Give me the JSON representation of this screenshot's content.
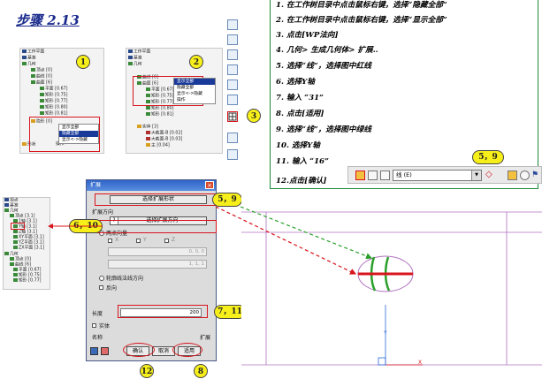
{
  "title": "步骤 2.13",
  "instructions": [
    "1. 在工作树目录中点击鼠标右键，选择“隐藏全部”",
    "2. 在工作树目录中点击鼠标右键，选择“显示全部”",
    "3. 点击[WP法向]",
    "4. 几何> 生成几何体> 扩展..",
    "5. 选择“线”，选择图中红线",
    "6. 选择Y轴",
    "7. 输入 “31”",
    "8. 点击[适用]",
    "9. 选择“线”，选择图中绿线",
    "10. 选择Y轴",
    "11. 输入 “16”",
    "12.点击[确认]"
  ],
  "badges": {
    "b1": "1",
    "b2": "2",
    "b3": "3",
    "b5_9_top": "5，9",
    "b5_9_dialog": "5，9",
    "b6_10": "6，10",
    "b7_11": "7，11",
    "b12": "12",
    "b8": "8"
  },
  "tree1": {
    "rows": [
      "工作平面",
      "基准",
      "几何",
      "顶点 [0]",
      "曲线 [0]",
      "曲面 [6]",
      "平面 [0.67]",
      "矩形 [0.75]",
      "矩形 [0.77]",
      "矩形 [0.80]",
      "矩形 [0.81]",
      "隐形 [0]",
      "形状",
      "操作"
    ],
    "menu": [
      "显示全部",
      "隐藏全部",
      "显示<->隐藏"
    ]
  },
  "tree2": {
    "rows": [
      "工作平面",
      "基准",
      "几何",
      "曲线 [0]",
      "曲面 [6]",
      "平面 [0.67]",
      "矩形 [0.75]",
      "矩形 [0.77]",
      "矩形 [0.80]",
      "矩形 [0.81]",
      "实体 [3]",
      "大截面-B [0.02]",
      "大截面-B [0.03]",
      "主 [0.04]"
    ],
    "menu": [
      "显示全部",
      "隐藏全部",
      "显示<->隐藏",
      "操作"
    ]
  },
  "tree3": {
    "rows": [
      "视点",
      "基准",
      "几何",
      "顶点 [3.1]",
      "1轴 [3.1]",
      "Y轴 [3.1]",
      "Z轴 [3.1]",
      "XY平面 [3.1]",
      "YZ平面 [3.1]",
      "ZX平面 [3.1]",
      "几何",
      "顶点 [0]",
      "曲线 [6]",
      "平面 [0.67]",
      "矩形 [0.75]",
      "矩形 [0.77]"
    ]
  },
  "dialog": {
    "title": "扩展",
    "select_shape_button": "选择扩展形状",
    "extend_direction_label": "扩展方向",
    "select_direction_button": "选择扩展方向",
    "two_point_vector": "两点向量",
    "x_label": "X",
    "y_label": "Y",
    "z_label": "Z",
    "coord1": "0, 0, 0",
    "coord2": "1, 1, 1",
    "contour_normal": "轮廓线法线方向",
    "reverse": "反向",
    "length_label": "长度",
    "length_value": "200",
    "solid_label": "实体",
    "name_label": "名称",
    "name_value": "扩展",
    "ok_button": "确认",
    "cancel_button": "取消",
    "apply_button": "适用"
  },
  "toolbar": {
    "dropdown_value": "线 (E)"
  },
  "colors": {
    "title": "#1a2a8c",
    "badge": "#f7ef1a",
    "highlight": "#d8141c",
    "green": "#2aa02a",
    "frame": "#b070c0"
  }
}
